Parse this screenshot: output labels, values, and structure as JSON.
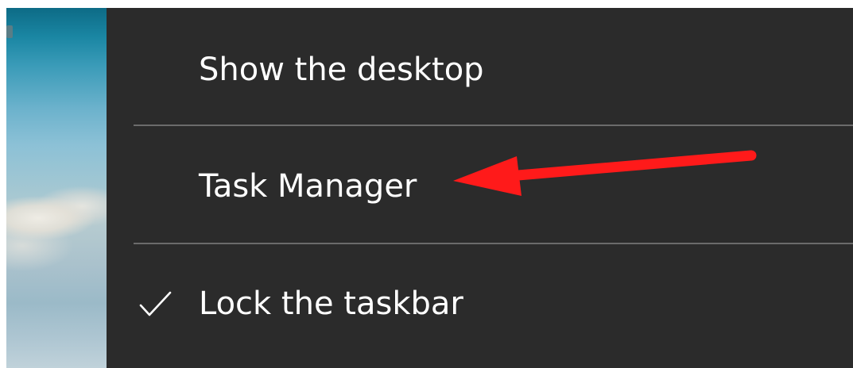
{
  "menu": {
    "items": [
      {
        "label": "Show the desktop",
        "checked": false
      },
      {
        "label": "Task Manager",
        "checked": false
      },
      {
        "label": "Lock the taskbar",
        "checked": true
      }
    ]
  },
  "annotation": {
    "arrow_color": "#ff1a1a",
    "points_to": "Task Manager"
  },
  "colors": {
    "menu_background": "#2b2b2b",
    "menu_text": "#ffffff",
    "divider": "#6b6b6b"
  },
  "icons": {
    "check": "checkmark-icon"
  }
}
